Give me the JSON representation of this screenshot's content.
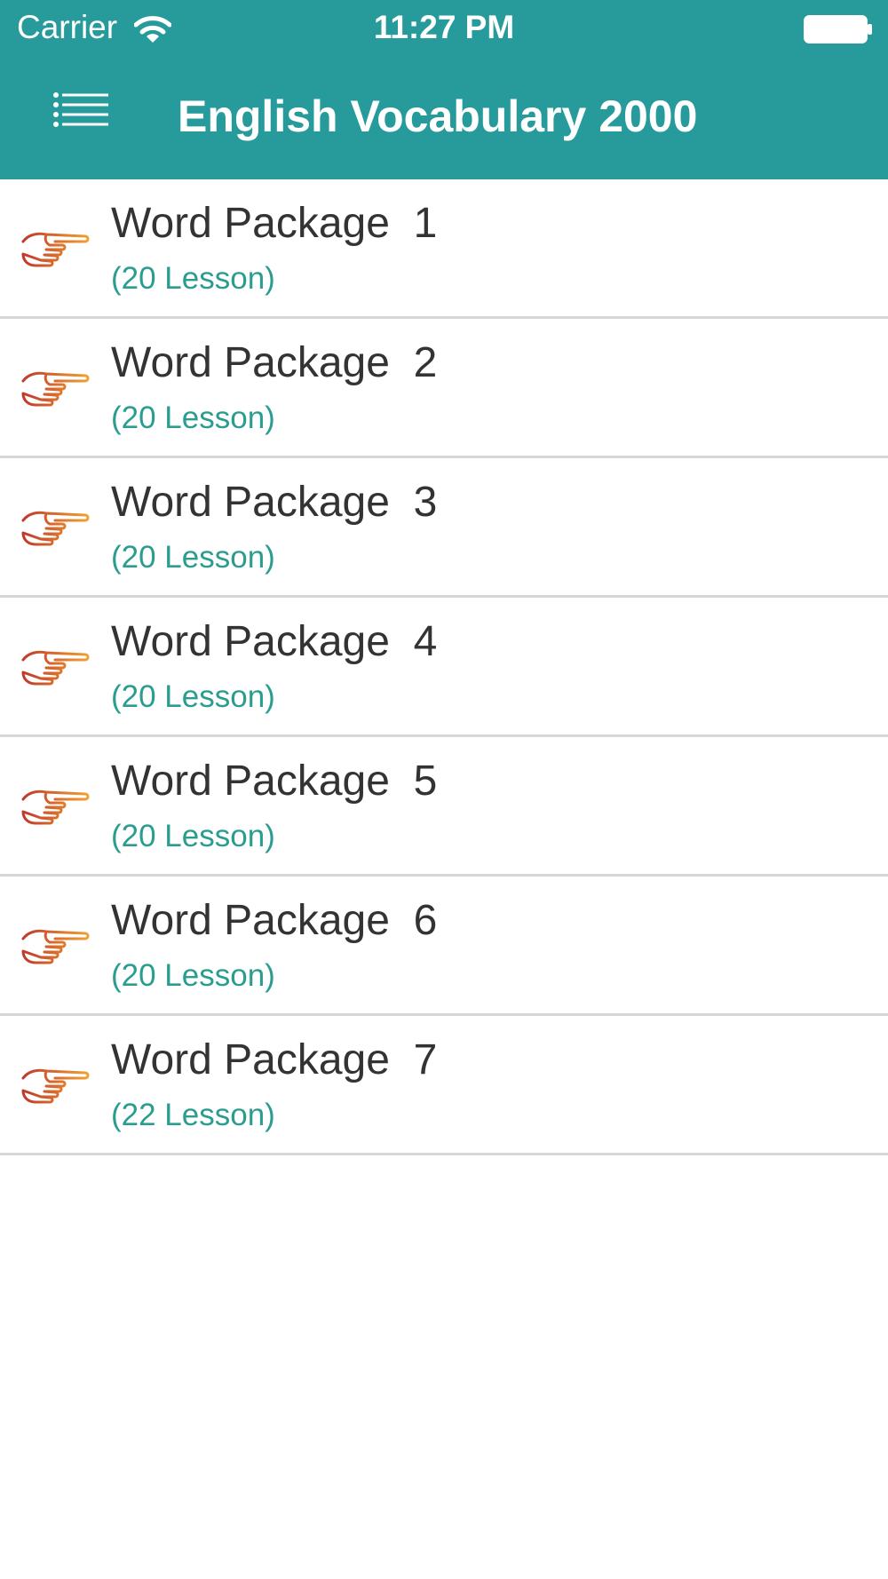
{
  "status_bar": {
    "carrier": "Carrier",
    "time": "11:27 PM",
    "wifi_icon": "wifi-icon",
    "battery_icon": "battery-icon"
  },
  "nav": {
    "menu_icon": "menu-list-icon",
    "title": "English Vocabulary 2000"
  },
  "colors": {
    "header": "#279b9b",
    "subtitle": "#2a9d8f",
    "title_text": "#333333",
    "divider": "#d6d6d6"
  },
  "packages": [
    {
      "title": "Word Package  1",
      "lessons": "(20 Lesson)",
      "icon": "pointing-hand-icon"
    },
    {
      "title": "Word Package  2",
      "lessons": "(20 Lesson)",
      "icon": "pointing-hand-icon"
    },
    {
      "title": "Word Package  3",
      "lessons": "(20 Lesson)",
      "icon": "pointing-hand-icon"
    },
    {
      "title": "Word Package  4",
      "lessons": "(20 Lesson)",
      "icon": "pointing-hand-icon"
    },
    {
      "title": "Word Package  5",
      "lessons": "(20 Lesson)",
      "icon": "pointing-hand-icon"
    },
    {
      "title": "Word Package  6",
      "lessons": "(20 Lesson)",
      "icon": "pointing-hand-icon"
    },
    {
      "title": "Word Package  7",
      "lessons": "(22 Lesson)",
      "icon": "pointing-hand-icon"
    }
  ]
}
